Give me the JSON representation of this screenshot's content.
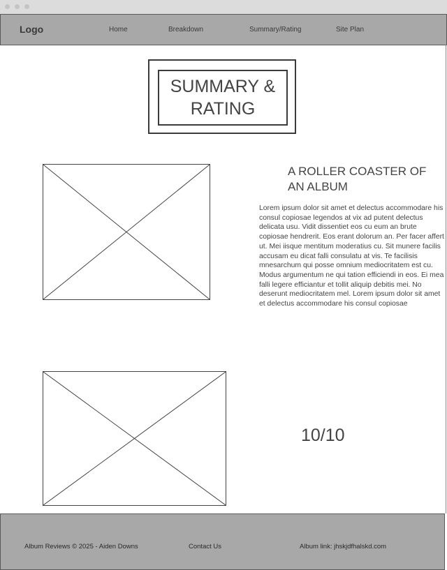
{
  "header": {
    "logo": "Logo",
    "nav": [
      "Home",
      "Breakdown",
      "Summary/Rating",
      "Site Plan"
    ]
  },
  "main": {
    "title": "SUMMARY & RATING",
    "subheading": "A ROLLER COASTER OF AN ALBUM",
    "body": "Lorem ipsum dolor sit amet et delectus accommodare his consul copiosae legendos at vix ad putent delectus delicata usu. Vidit dissentiet eos cu eum an brute copiosae hendrerit. Eos erant dolorum an. Per facer affert ut. Mei iisque mentitum moderatius cu. Sit munere facilis accusam eu dicat falli consulatu at vis. Te facilisis mnesarchum qui posse omnium mediocritatem est cu. Modus argumentum ne qui tation efficiendi in eos. Ei mea falli legere efficiantur et tollit aliquip debitis mei. No deserunt mediocritatem mel. Lorem ipsum dolor sit amet et delectus accommodare his consul copiosae",
    "rating": "10/10"
  },
  "footer": {
    "copyright": "Album Reviews © 2025 - Aiden Downs",
    "contact": "Contact Us",
    "album_link": "Album link: jhskjdfhalskd.com"
  },
  "colors": {
    "bar": "#a8a8a8",
    "text": "#444444"
  }
}
